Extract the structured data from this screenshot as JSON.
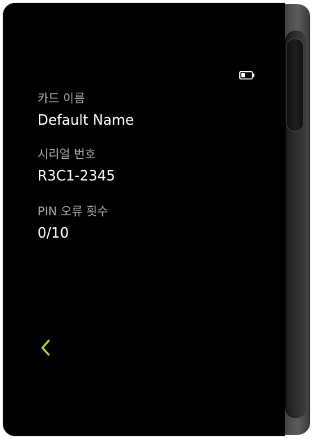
{
  "status": {
    "battery_icon": "battery-low-icon"
  },
  "card_info": {
    "name_label": "카드 이름",
    "name_value": "Default Name",
    "serial_label": "시리얼 번호",
    "serial_value": "R3C1-2345",
    "pin_label": "PIN 오류 횟수",
    "pin_value": "0/10"
  },
  "nav": {
    "back_icon": "chevron-left-icon"
  },
  "colors": {
    "screen_bg": "#000000",
    "label": "#a8a8a8",
    "value": "#ffffff",
    "accent": "#a6d22e"
  }
}
